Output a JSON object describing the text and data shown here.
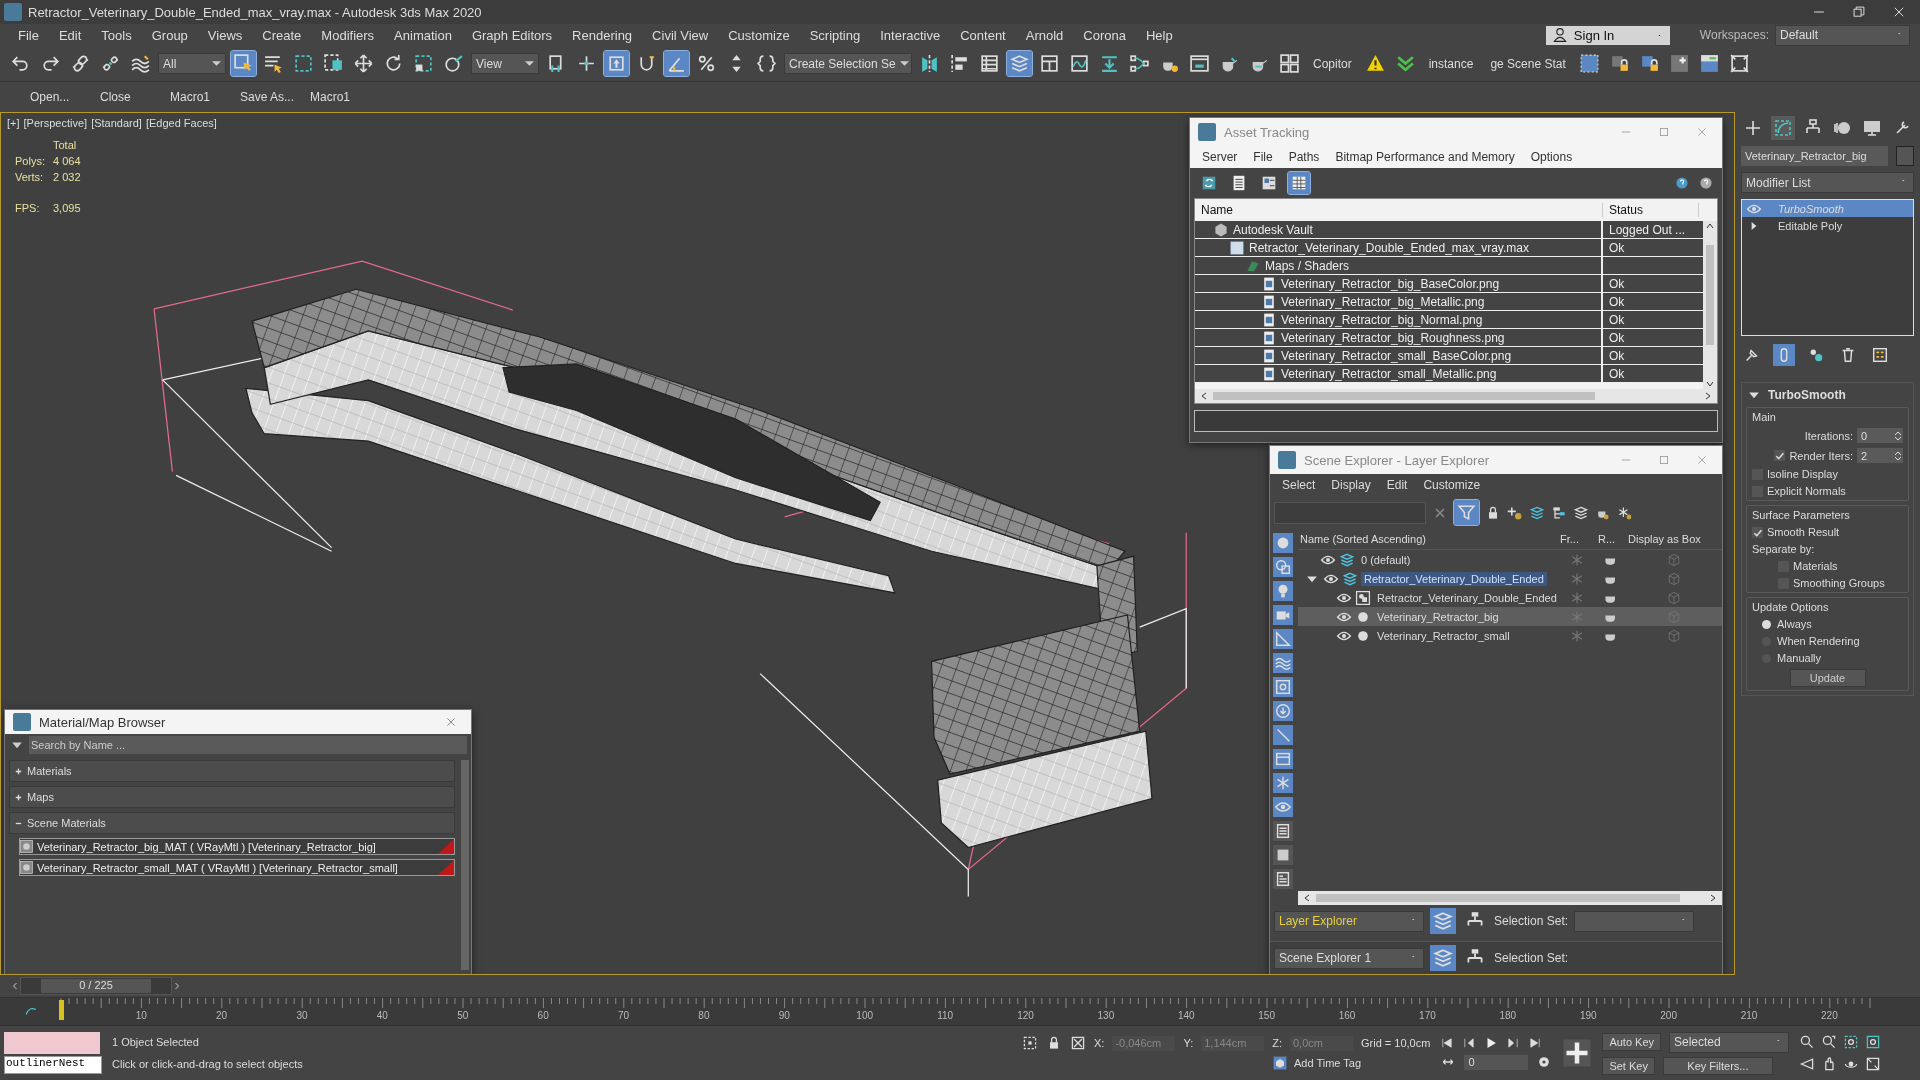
{
  "window": {
    "title": "Retractor_Veterinary_Double_Ended_max_vray.max - Autodesk 3ds Max 2020"
  },
  "menu": [
    "File",
    "Edit",
    "Tools",
    "Group",
    "Views",
    "Create",
    "Modifiers",
    "Animation",
    "Graph Editors",
    "Rendering",
    "Civil View",
    "Customize",
    "Scripting",
    "Interactive",
    "Content",
    "Arnold",
    "Corona",
    "Help"
  ],
  "account": {
    "sign_in": "Sign In",
    "workspaces_label": "Workspaces:",
    "workspace": "Default"
  },
  "toolbar": [
    {
      "kind": "icon",
      "selected": false
    },
    {
      "kind": "icon",
      "selected": false
    },
    {
      "kind": "icon",
      "selected": false
    },
    {
      "kind": "icon",
      "selected": false
    },
    {
      "kind": "icon",
      "selected": false
    },
    {
      "kind": "dropdown",
      "value": "All"
    },
    {
      "kind": "icon",
      "selected": true
    },
    {
      "kind": "icon",
      "selected": false
    },
    {
      "kind": "icon",
      "selected": false
    },
    {
      "kind": "icon",
      "selected": false
    },
    {
      "kind": "icon",
      "selected": false
    },
    {
      "kind": "icon",
      "selected": false
    },
    {
      "kind": "icon",
      "selected": false
    },
    {
      "kind": "icon",
      "selected": false
    },
    {
      "kind": "dropdown",
      "value": "View"
    },
    {
      "kind": "icon",
      "selected": false
    },
    {
      "kind": "icon",
      "selected": false
    },
    {
      "kind": "icon",
      "selected": true
    },
    {
      "kind": "icon",
      "selected": false
    },
    {
      "kind": "icon",
      "selected": true
    },
    {
      "kind": "icon",
      "selected": false
    },
    {
      "kind": "icon",
      "selected": false
    },
    {
      "kind": "icon",
      "selected": false
    },
    {
      "kind": "dropdown",
      "value": "Create Selection Se"
    },
    {
      "kind": "icon",
      "selected": false
    },
    {
      "kind": "icon",
      "selected": false
    },
    {
      "kind": "icon",
      "selected": false
    },
    {
      "kind": "icon",
      "selected": true
    },
    {
      "kind": "icon",
      "selected": false
    },
    {
      "kind": "icon",
      "selected": false
    },
    {
      "kind": "icon",
      "selected": false
    },
    {
      "kind": "icon",
      "selected": false
    },
    {
      "kind": "icon",
      "selected": false
    },
    {
      "kind": "icon",
      "selected": false
    },
    {
      "kind": "icon",
      "selected": false
    },
    {
      "kind": "icon",
      "selected": false
    },
    {
      "kind": "icon",
      "selected": false
    },
    {
      "kind": "label",
      "text": "Copitor"
    },
    {
      "kind": "icon",
      "selected": false
    },
    {
      "kind": "icon",
      "selected": false
    },
    {
      "kind": "label",
      "text": "instance"
    },
    {
      "kind": "label",
      "text": "ge Scene Stat"
    },
    {
      "kind": "icon",
      "selected": false
    },
    {
      "kind": "icon",
      "selected": false
    },
    {
      "kind": "icon",
      "selected": false
    },
    {
      "kind": "icon",
      "selected": false
    },
    {
      "kind": "icon",
      "selected": false
    },
    {
      "kind": "icon",
      "selected": false
    }
  ],
  "macros": [
    "Open...",
    "Close",
    "Macro1",
    "Save As...",
    "Macro1"
  ],
  "viewport": {
    "labels": [
      "[+]",
      "[Perspective]",
      "[Standard]",
      "[Edged Faces]"
    ],
    "stats": {
      "header": "Total",
      "rows": [
        {
          "label": "Polys:",
          "value": "4 064"
        },
        {
          "label": "Verts:",
          "value": "2 032"
        }
      ],
      "fps_label": "FPS:",
      "fps": "3,095"
    }
  },
  "asset_tracking": {
    "title": "Asset Tracking",
    "menu": [
      "Server",
      "File",
      "Paths",
      "Bitmap Performance and Memory",
      "Options"
    ],
    "tools": [
      {
        "selected": false
      },
      {
        "selected": false
      },
      {
        "selected": false
      },
      {
        "selected": true
      }
    ],
    "columns": [
      "Name",
      "Status"
    ],
    "rows": [
      {
        "kind": "vault",
        "name": "Autodesk Vault",
        "status": "Logged Out ...",
        "children": [
          {
            "kind": "file",
            "name": "Retractor_Veterinary_Double_Ended_max_vray.max",
            "status": "Ok",
            "children": [
              {
                "kind": "folder",
                "name": "Maps / Shaders",
                "children": [
                  {
                    "kind": "bitmap",
                    "name": "Veterinary_Retractor_big_BaseColor.png",
                    "status": "Ok"
                  },
                  {
                    "kind": "bitmap",
                    "name": "Veterinary_Retractor_big_Metallic.png",
                    "status": "Ok"
                  },
                  {
                    "kind": "bitmap",
                    "name": "Veterinary_Retractor_big_Normal.png",
                    "status": "Ok"
                  },
                  {
                    "kind": "bitmap",
                    "name": "Veterinary_Retractor_big_Roughness.png",
                    "status": "Ok"
                  },
                  {
                    "kind": "bitmap",
                    "name": "Veterinary_Retractor_small_BaseColor.png",
                    "status": "Ok"
                  },
                  {
                    "kind": "bitmap",
                    "name": "Veterinary_Retractor_small_Metallic.png",
                    "status": "Ok"
                  }
                ]
              }
            ]
          }
        ]
      }
    ]
  },
  "scene_explorer": {
    "title": "Scene Explorer - Layer Explorer",
    "menu": [
      "Select",
      "Display",
      "Edit",
      "Customize"
    ],
    "filter_selected": true,
    "filters": [
      {
        "on": true
      },
      {
        "on": true
      },
      {
        "on": true
      },
      {
        "on": true
      },
      {
        "on": true
      },
      {
        "on": true
      },
      {
        "on": true
      },
      {
        "on": true
      },
      {
        "on": true
      },
      {
        "on": true
      },
      {
        "on": true
      },
      {
        "on": true
      },
      {
        "on": false
      },
      {
        "on": false
      },
      {
        "on": false
      }
    ],
    "columns": [
      "Name (Sorted Ascending)",
      "Fr...",
      "R...",
      "Display as Box"
    ],
    "rows": [
      {
        "kind": "layer",
        "name": "0 (default)",
        "active": false,
        "selected": false
      },
      {
        "kind": "layer",
        "name": "Retractor_Veterinary_Double_Ended",
        "active": true,
        "selected": false,
        "expanded": true,
        "children": [
          {
            "kind": "group",
            "name": "Retractor_Veterinary_Double_Ended",
            "active": false,
            "selected": false
          },
          {
            "kind": "object",
            "name": "Veterinary_Retractor_big",
            "active": false,
            "selected": true
          },
          {
            "kind": "object",
            "name": "Veterinary_Retractor_small",
            "active": false,
            "selected": false
          }
        ]
      }
    ],
    "explorer": "Layer Explorer",
    "selection_set_label": "Selection Set:",
    "docked_explorer": "Scene Explorer 1",
    "docked_selection_set_label": "Selection Set:"
  },
  "material_browser": {
    "title": "Material/Map Browser",
    "search": {
      "placeholder": "Search by Name ..."
    },
    "groups": [
      {
        "label": "Materials",
        "expanded": false
      },
      {
        "label": "Maps",
        "expanded": false
      },
      {
        "label": "Scene Materials",
        "expanded": true,
        "items": [
          "Veterinary_Retractor_big_MAT ( VRayMtl ) [Veterinary_Retractor_big]",
          "Veterinary_Retractor_small_MAT ( VRayMtl ) [Veterinary_Retractor_small]"
        ]
      }
    ]
  },
  "command_panel": {
    "tabs": [
      {
        "selected": false
      },
      {
        "selected": true
      },
      {
        "selected": false
      },
      {
        "selected": false
      },
      {
        "selected": false
      },
      {
        "selected": false
      }
    ],
    "object_name": "Veterinary_Retractor_big",
    "modifier_list": "Modifier List",
    "stack": [
      {
        "kind": "modifier",
        "name": "TurboSmooth",
        "selected": true
      },
      {
        "kind": "object",
        "name": "Editable Poly",
        "selected": false
      }
    ],
    "stack_tools": [
      {
        "selected": false
      },
      {
        "selected": true
      },
      {
        "selected": false
      },
      {
        "selected": false
      },
      {
        "selected": false
      }
    ],
    "rollout": {
      "title": "TurboSmooth",
      "main": {
        "title": "Main",
        "iterations_label": "Iterations:",
        "iterations": "0",
        "render_iters": {
          "label": "Render Iters:",
          "checked": true,
          "value": "2"
        },
        "options": [
          {
            "label": "Isoline Display",
            "checked": false
          },
          {
            "label": "Explicit Normals",
            "checked": false
          }
        ]
      },
      "surface": {
        "title": "Surface Parameters",
        "smooth_result": {
          "label": "Smooth Result",
          "checked": true
        },
        "separate_label": "Separate by:",
        "separate": [
          {
            "label": "Materials",
            "checked": false
          },
          {
            "label": "Smoothing Groups",
            "checked": false
          }
        ]
      },
      "update": {
        "title": "Update Options",
        "options": [
          {
            "label": "Always",
            "selected": true
          },
          {
            "label": "When Rendering",
            "selected": false
          },
          {
            "label": "Manually",
            "selected": false
          }
        ],
        "button": "Update"
      }
    }
  },
  "timeline": {
    "slider": "0 / 225",
    "ruler": [
      "10",
      "20",
      "30",
      "40",
      "50",
      "60",
      "70",
      "80",
      "90",
      "100",
      "110",
      "120",
      "130",
      "140",
      "150",
      "160",
      "170",
      "180",
      "190",
      "200",
      "210",
      "220"
    ]
  },
  "status_bar": {
    "script_field": "outlinerNest",
    "selected": "1 Object Selected",
    "prompt": "Click or click-and-drag to select objects",
    "coords": [
      {
        "label": "X:",
        "value": "-0,046cm",
        "disabled": true
      },
      {
        "label": "Y:",
        "value": "1,144cm",
        "disabled": true
      },
      {
        "label": "Z:",
        "value": "0,0cm",
        "disabled": true
      }
    ],
    "grid": "Grid = 10,0cm",
    "time_tag": "Add Time Tag",
    "frame": "0",
    "auto_key": "Auto Key",
    "key_mode": "Selected",
    "set_key": "Set Key",
    "key_filters": "Key Filters..."
  }
}
